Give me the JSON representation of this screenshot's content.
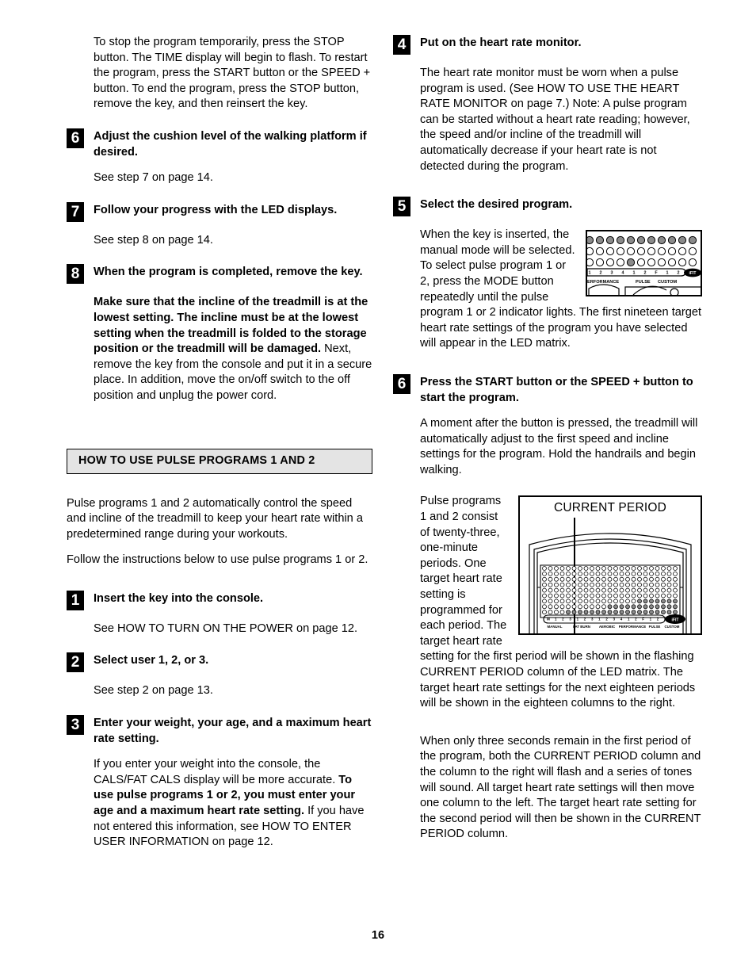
{
  "page": {
    "number": "16"
  },
  "left_column": {
    "intro_paragraph": "To stop the program temporarily, press the STOP button. The TIME display will begin to flash. To restart the program, press the START button or the SPEED + button. To end the program, press the STOP button, remove the key, and then reinsert the key.",
    "steps": [
      {
        "number": "6",
        "title": "Adjust the cushion level of the walking platform if desired.",
        "body": "See step 7 on page 14."
      },
      {
        "number": "7",
        "title": "Follow your progress with the LED displays.",
        "body": "See step 8 on page 14."
      },
      {
        "number": "8",
        "title": "When the program is completed, remove the key.",
        "body_bold": "Make sure that the incline of the treadmill is at the lowest setting. The incline must be at the lowest setting when the treadmill is folded to the storage position or the treadmill will be damaged.",
        "body_rest": " Next, remove the key from the console and put it in a secure place. In addition, move the on/off switch to the off position and unplug the power cord."
      }
    ],
    "section_header": "HOW TO USE PULSE PROGRAMS 1 AND 2",
    "section_intro_1": "Pulse programs 1 and 2 automatically control the speed and incline of the treadmill to keep your heart rate within a predetermined range during your workouts.",
    "section_intro_2": "Follow the instructions below to use pulse programs 1 or 2.",
    "pulse_steps": [
      {
        "number": "1",
        "title": "Insert the key into the console.",
        "body": "See HOW TO TURN ON THE POWER on page 12."
      },
      {
        "number": "2",
        "title": "Select user 1, 2, or 3.",
        "body": "See step 2 on page 13."
      },
      {
        "number": "3",
        "title": "Enter your weight, your age, and a maximum heart rate setting.",
        "body_pre": "If you enter your weight into the console, the CALS/FAT CALS display will be more accurate. ",
        "body_bold": "To use pulse programs 1 or 2, you must enter your age and a maximum heart rate setting.",
        "body_post": " If you have not entered this information, see HOW TO ENTER USER INFORMATION on page 12."
      }
    ]
  },
  "right_column": {
    "steps": [
      {
        "number": "4",
        "title": "Put on the heart rate monitor.",
        "body": "The heart rate monitor must be worn when a pulse program is used. (See HOW TO USE THE HEART RATE MONITOR on page 7.) Note: A pulse program can be started without a heart rate reading; however, the speed and/or incline of the treadmill will automatically decrease if your heart rate is not detected during the program."
      },
      {
        "number": "5",
        "title": "Select the desired program.",
        "body": "When the key is inserted, the manual mode will be selected. To select pulse program 1 or 2, press the MODE button repeatedly until the pulse program 1 or 2 indicator lights. The first nineteen target heart rate settings of the program you have selected will appear in the LED matrix."
      },
      {
        "number": "6",
        "title": "Press the START button or the SPEED + button to start the program.",
        "body": "A moment after the button is pressed, the treadmill will automatically adjust to the first speed and incline settings for the program. Hold the handrails and begin walking."
      }
    ],
    "period_paragraph": "Pulse programs 1 and 2 consist of twenty-three, one-minute periods. One target heart rate setting is programmed for each period. The target heart rate setting for the first period will be shown in the flashing CURRENT PERIOD column of the LED matrix. The target heart rate settings for the next eighteen periods will be shown in the eighteen columns to the right.",
    "final_paragraph": "When only three seconds remain in the first period of the program, both the CURRENT PERIOD column and the column to the right will flash and a series of tones will sound. All target heart rate settings will then move one column to the left. The target heart rate setting for the second period will then be shown in the CURRENT PERIOD column."
  },
  "figures": {
    "console_closeup": {
      "name": "console-closeup",
      "digit_labels": [
        "1",
        "2",
        "3",
        "4",
        "1",
        "2",
        "F",
        "1",
        "2"
      ],
      "group_labels": [
        "ERFORMANCE",
        "PULSE",
        "CUSTOM"
      ],
      "brand": "iFIT.com"
    },
    "current_period": {
      "name": "current-period-diagram",
      "caption": "CURRENT PERIOD",
      "digit_labels": [
        "M",
        "1",
        "2",
        "3",
        "1",
        "2",
        "3",
        "1",
        "2",
        "3",
        "4",
        "1",
        "2",
        "F",
        "1",
        "2"
      ],
      "group_labels": [
        "MANUAL",
        "FAT BURN",
        "AEROBIC",
        "PERFORMANCE",
        "PULSE",
        "CUSTOM"
      ],
      "brand": "iFIT.com",
      "matrix_rows": 9,
      "matrix_cols": 23
    }
  },
  "colors": {
    "text": "#000000",
    "section_bar_bg": "#e4e4e4",
    "badge_bg": "#000000",
    "badge_fg": "#ffffff",
    "led_on": "#8a8a8a"
  }
}
